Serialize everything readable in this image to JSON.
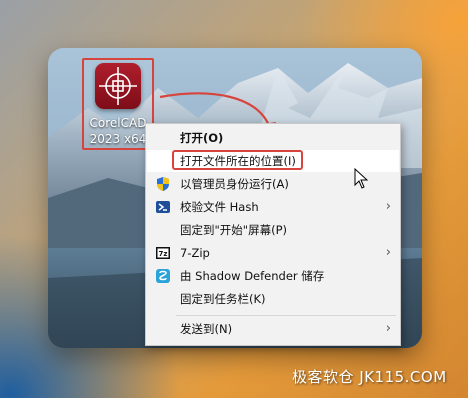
{
  "desktop_icon": {
    "label_line1": "CorelCAD",
    "label_line2": "2023 x64",
    "icon_name": "corelcad-logo-icon"
  },
  "context_menu": {
    "items": [
      {
        "label": "打开(O)",
        "bold": true
      },
      {
        "label": "打开文件所在的位置(I)",
        "highlighted": true
      },
      {
        "label": "以管理员身份运行(A)",
        "icon": "shield-icon"
      },
      {
        "label": "校验文件 Hash",
        "icon": "powershell-icon",
        "submenu": true
      },
      {
        "label": "固定到\"开始\"屏幕(P)"
      },
      {
        "label": "7-Zip",
        "icon": "7zip-icon",
        "submenu": true
      },
      {
        "label": "由 Shadow Defender 储存",
        "icon": "shadow-defender-icon"
      },
      {
        "label": "固定到任务栏(K)"
      },
      {
        "label": "发送到(N)",
        "submenu": true
      }
    ],
    "submenu_arrow": "›"
  },
  "watermark": "极客软仓 JK115.COM",
  "colors": {
    "highlight_red": "#d6443b",
    "menu_bg": "#f2f2f2"
  }
}
